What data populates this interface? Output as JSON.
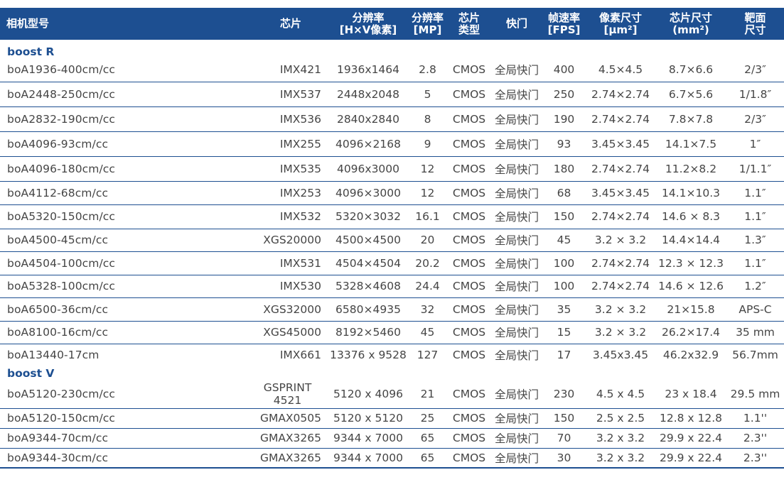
{
  "headers": {
    "model": "相机型号",
    "chip": "芯片",
    "resolution": "分辨率\n[H×V像素]",
    "mp": "分辨率\n[MP]",
    "chip_type": "芯片\n类型",
    "shutter": "快门",
    "fps": "帧速率\n[FPS]",
    "pixel_size": "像素尺寸\n[μm²]",
    "chip_size": "芯片尺寸\n(mm²)",
    "target_size": "靶面\n尺寸"
  },
  "sections": [
    {
      "title": "boost R",
      "rows": [
        {
          "model": "boA1936-400cm/cc",
          "chip": "IMX421",
          "resolution": "1936x1464",
          "mp": "2.8",
          "type": "CMOS",
          "shutter": "全局快门",
          "fps": "400",
          "pixel": "4.5×4.5",
          "size": "8.7×6.6",
          "target": "2/3″"
        },
        {
          "model": "boA2448-250cm/cc",
          "chip": "IMX537",
          "resolution": "2448x2048",
          "mp": "5",
          "type": "CMOS",
          "shutter": "全局快门",
          "fps": "250",
          "pixel": "2.74×2.74",
          "size": "6.7×5.6",
          "target": "1/1.8″"
        },
        {
          "model": "boA2832-190cm/cc",
          "chip": "IMX536",
          "resolution": "2840x2840",
          "mp": "8",
          "type": "CMOS",
          "shutter": "全局快门",
          "fps": "190",
          "pixel": "2.74×2.74",
          "size": "7.8×7.8",
          "target": "2/3″"
        },
        {
          "model": "boA4096-93cm/cc",
          "chip": "IMX255",
          "resolution": "4096×2168",
          "mp": "9",
          "type": "CMOS",
          "shutter": "全局快门",
          "fps": "93",
          "pixel": "3.45×3.45",
          "size": "14.1×7.5",
          "target": "1″"
        },
        {
          "model": "boA4096-180cm/cc",
          "chip": "IMX535",
          "resolution": "4096x3000",
          "mp": "12",
          "type": "CMOS",
          "shutter": "全局快门",
          "fps": "180",
          "pixel": "2.74×2.74",
          "size": "11.2×8.2",
          "target": "1/1.1″"
        },
        {
          "model": "boA4112-68cm/cc",
          "chip": "IMX253",
          "resolution": "4096×3000",
          "mp": "12",
          "type": "CMOS",
          "shutter": "全局快门",
          "fps": "68",
          "pixel": "3.45×3.45",
          "size": "14.1×10.3",
          "target": "1.1″"
        },
        {
          "model": "boA5320-150cm/cc",
          "chip": "IMX532",
          "resolution": "5320×3032",
          "mp": "16.1",
          "type": "CMOS",
          "shutter": "全局快门",
          "fps": "150",
          "pixel": "2.74×2.74",
          "size": "14.6 × 8.3",
          "target": "1.1″"
        },
        {
          "model": "boA4500-45cm/cc",
          "chip": "XGS20000",
          "resolution": "4500×4500",
          "mp": "20",
          "type": "CMOS",
          "shutter": "全局快门",
          "fps": "45",
          "pixel": "3.2 × 3.2",
          "size": "14.4×14.4",
          "target": "1.3″"
        },
        {
          "model": "boA4504-100cm/cc",
          "chip": "IMX531",
          "resolution": "4504×4504",
          "mp": "20.2",
          "type": "CMOS",
          "shutter": "全局快门",
          "fps": "100",
          "pixel": "2.74×2.74",
          "size": "12.3 × 12.3",
          "target": "1.1″"
        },
        {
          "model": "boA5328-100cm/cc",
          "chip": "IMX530",
          "resolution": "5328×4608",
          "mp": "24.4",
          "type": "CMOS",
          "shutter": "全局快门",
          "fps": "100",
          "pixel": "2.74×2.74",
          "size": "14.6 × 12.6",
          "target": "1.2″"
        },
        {
          "model": "boA6500-36cm/cc",
          "chip": "XGS32000",
          "resolution": "6580×4935",
          "mp": "32",
          "type": "CMOS",
          "shutter": "全局快门",
          "fps": "35",
          "pixel": "3.2 × 3.2",
          "size": "21×15.8",
          "target": "APS-C"
        },
        {
          "model": "boA8100-16cm/cc",
          "chip": "XGS45000",
          "resolution": "8192×5460",
          "mp": "45",
          "type": "CMOS",
          "shutter": "全局快门",
          "fps": "15",
          "pixel": "3.2 × 3.2",
          "size": "26.2×17.4",
          "target": "35 mm"
        },
        {
          "model": "boA13440-17cm",
          "chip": "IMX661",
          "resolution": "13376 x 9528",
          "mp": "127",
          "type": "CMOS",
          "shutter": "全局快门",
          "fps": "17",
          "pixel": "3.45x3.45",
          "size": "46.2x32.9",
          "target": "56.7mm"
        }
      ]
    },
    {
      "title": "boost V",
      "rows": [
        {
          "model": "boA5120-230cm/cc",
          "chip": "GSPRINT\n4521",
          "resolution": "5120 x 4096",
          "mp": "21",
          "type": "CMOS",
          "shutter": "全局快门",
          "fps": "230",
          "pixel": "4.5 x 4.5",
          "size": "23 x 18.4",
          "target": "29.5 mm"
        },
        {
          "model": "boA5120-150cm/cc",
          "chip": "GMAX0505",
          "resolution": "5120 x 5120",
          "mp": "25",
          "type": "CMOS",
          "shutter": "全局快门",
          "fps": "150",
          "pixel": "2.5 x 2.5",
          "size": "12.8 x 12.8",
          "target": "1.1''"
        },
        {
          "model": "boA9344-70cm/cc",
          "chip": "GMAX3265",
          "resolution": "9344 x 7000",
          "mp": "65",
          "type": "CMOS",
          "shutter": "全局快门",
          "fps": "70",
          "pixel": "3.2 x 3.2",
          "size": "29.9 x 22.4",
          "target": "2.3''"
        },
        {
          "model": "boA9344-30cm/cc",
          "chip": "GMAX3265",
          "resolution": "9344 x 7000",
          "mp": "65",
          "type": "CMOS",
          "shutter": "全局快门",
          "fps": "30",
          "pixel": "3.2 x 3.2",
          "size": "29.9 x 22.4",
          "target": "2.3''"
        }
      ]
    }
  ],
  "colors": {
    "header_bg": "#1d4f91",
    "section_title": "#1d4f91",
    "row_divider": "#1d4f91",
    "cell_text": "#454545"
  }
}
